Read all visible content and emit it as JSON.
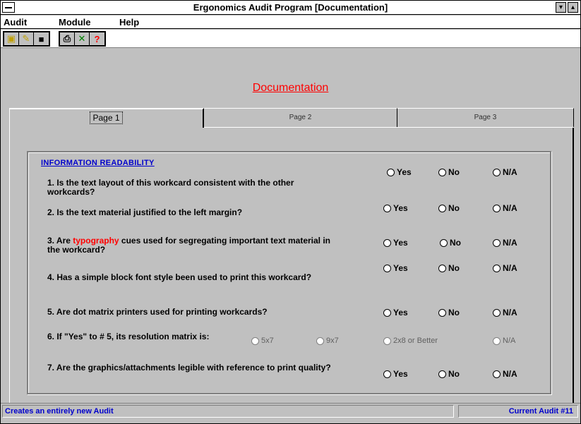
{
  "window": {
    "title": "Ergonomics Audit Program    [Documentation]"
  },
  "menu": {
    "items": [
      {
        "label": "Audit"
      },
      {
        "label": "Module"
      },
      {
        "label": "Help"
      }
    ]
  },
  "toolbar": {
    "buttons": [
      {
        "icon": "new-file-icon",
        "glyph": "▣",
        "color": "#c0a000"
      },
      {
        "icon": "open-folder-icon",
        "glyph": "✎",
        "color": "#c0a000"
      },
      {
        "icon": "save-disk-icon",
        "glyph": "■",
        "color": "#000000"
      },
      {
        "icon": "print-icon",
        "glyph": "⎙",
        "color": "#000000"
      },
      {
        "icon": "run-icon",
        "glyph": "✕",
        "color": "#008000"
      },
      {
        "icon": "help-icon",
        "glyph": "?",
        "color": "#ff0000"
      }
    ]
  },
  "heading": "Documentation",
  "tabs": [
    {
      "label": "Page 1"
    },
    {
      "label": "Page 2"
    },
    {
      "label": "Page 3"
    }
  ],
  "section_title": "INFORMATION READABILITY",
  "questions": [
    {
      "text": "1. Is the text layout of this workcard consistent with the other workcards?",
      "options": [
        "Yes",
        "No",
        "N/A"
      ]
    },
    {
      "text": "2. Is the text material justified to the left margin?",
      "options": [
        "Yes",
        "No",
        "N/A"
      ]
    },
    {
      "text_before": "3. Are ",
      "text_highlight": "typography",
      "text_after": " cues used for segregating important text material in the workcard?",
      "options": [
        "Yes",
        "No",
        "N/A"
      ]
    },
    {
      "text": "4. Has a simple block font style been used to print this workcard?",
      "options": [
        "Yes",
        "No",
        "N/A"
      ]
    },
    {
      "text": "5. Are dot matrix printers used for printing workcards?",
      "options": [
        "Yes",
        "No",
        "N/A"
      ]
    },
    {
      "text": "6. If \"Yes\" to # 5, its resolution matrix is:",
      "options": [
        "5x7",
        "9x7",
        "2x8 or Better",
        "N/A"
      ]
    },
    {
      "text": "7. Are the graphics/attachments legible with reference to print quality?",
      "options": [
        "Yes",
        "No",
        "N/A"
      ]
    }
  ],
  "status": {
    "left": "Creates an entirely new Audit",
    "right": "Current Audit #11"
  },
  "colors": {
    "heading": "#ff0000",
    "section_title": "#0000cc",
    "status_text": "#0000cc",
    "highlight": "#ff0000"
  }
}
